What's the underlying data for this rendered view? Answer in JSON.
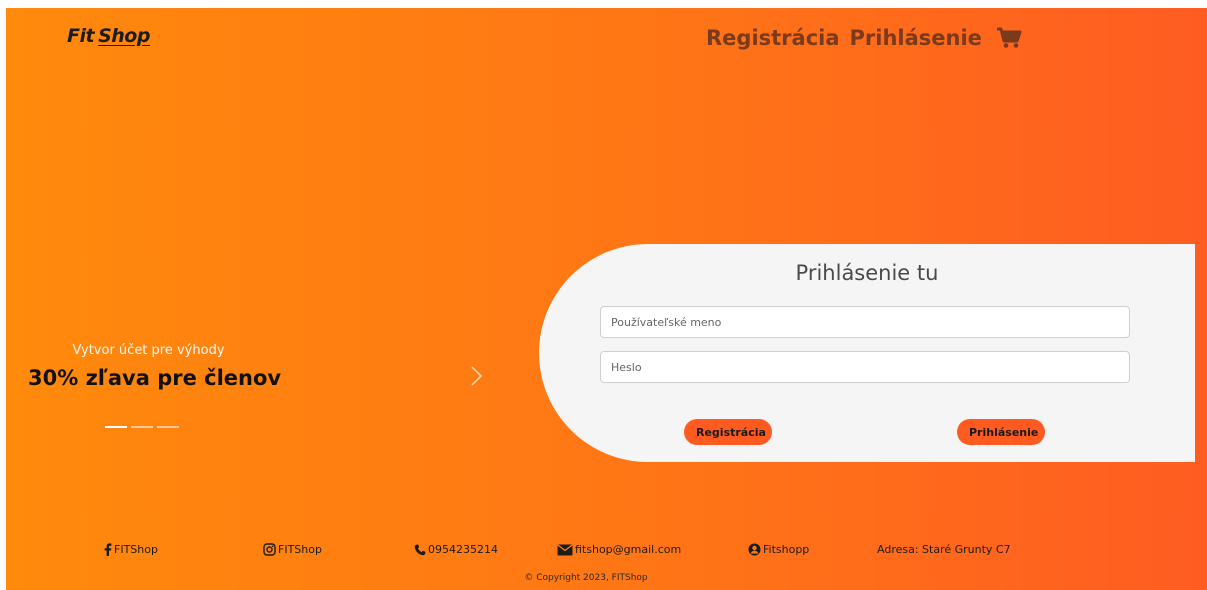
{
  "header": {
    "logo_fit": "Fit",
    "logo_shop": "Shop",
    "nav_register": "Registrácia",
    "nav_login": "Prihlásenie",
    "cart_icon": "shopping-cart-icon"
  },
  "carousel": {
    "subtitle": "Vytvor účet pre výhody",
    "title": "30% zľava pre členov",
    "slides": 3,
    "active_slide": 1
  },
  "login": {
    "title": "Prihlásenie tu",
    "username_placeholder": "Používateľské meno",
    "password_placeholder": "Heslo",
    "register_button": "Registrácia",
    "login_button": "Prihlásenie"
  },
  "footer": {
    "facebook": "FITShop",
    "instagram": "FITShop",
    "phone": "0954235214",
    "email": "fitshop@gmail.com",
    "other": "Fitshopp",
    "address": "Adresa: Staré Grunty C7",
    "copyright": "© Copyright 2023, FITShop"
  },
  "colors": {
    "gradient_start": "#ff8a0c",
    "gradient_end": "#ff5c22",
    "button": "#ff5a1f",
    "nav_text": "#7a3a1c"
  }
}
